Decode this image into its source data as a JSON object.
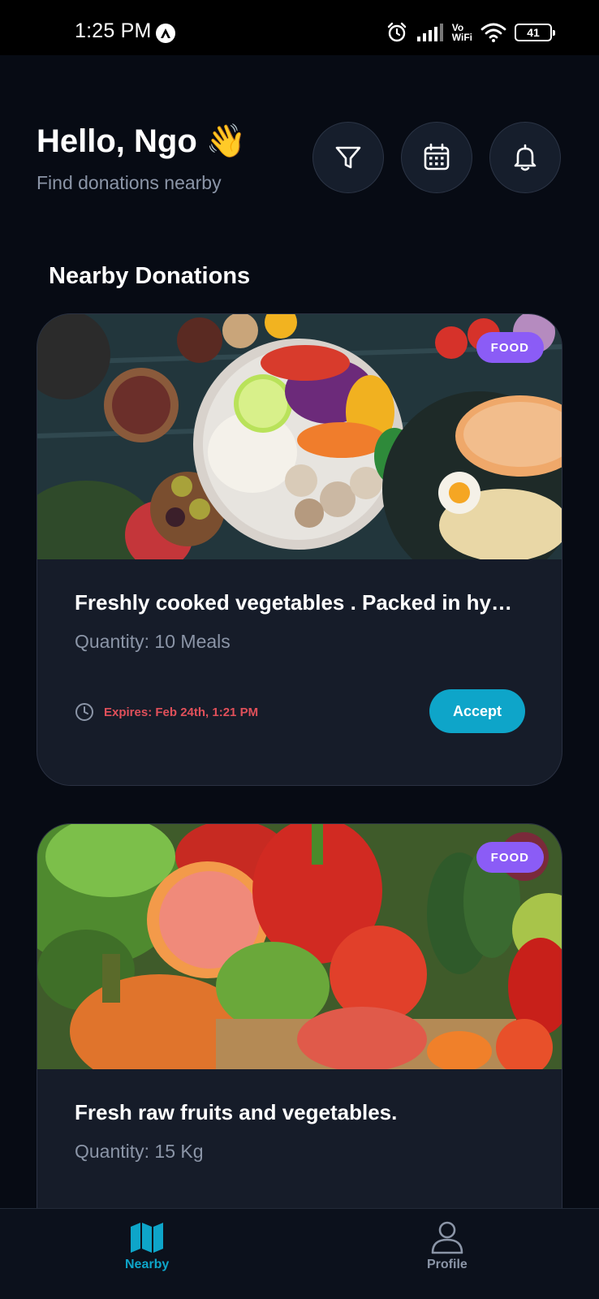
{
  "status_bar": {
    "time": "1:25 PM",
    "vowifi_top": "Vo",
    "vowifi_bottom": "WiFi",
    "battery": "41"
  },
  "header": {
    "greeting": "Hello, Ngo 👋",
    "subtitle": "Find donations nearby",
    "icons": [
      "filter-icon",
      "calendar-icon",
      "bell-icon"
    ]
  },
  "section_title": "Nearby Donations",
  "donations": [
    {
      "badge": "FOOD",
      "title": "Freshly cooked vegetables . Packed in hy…",
      "quantity": "Quantity: 10 Meals",
      "expires": "Expires: Feb 24th, 1:21 PM",
      "action": "Accept"
    },
    {
      "badge": "FOOD",
      "title": "Fresh raw fruits and vegetables.",
      "quantity": "Quantity: 15 Kg"
    }
  ],
  "bottom_nav": {
    "nearby": "Nearby",
    "profile": "Profile"
  },
  "colors": {
    "background": "#070b14",
    "card": "#161c29",
    "accent": "#0ea5c9",
    "badge": "#8b5cf6",
    "expires": "#e0505a",
    "muted": "#8b95a7"
  }
}
